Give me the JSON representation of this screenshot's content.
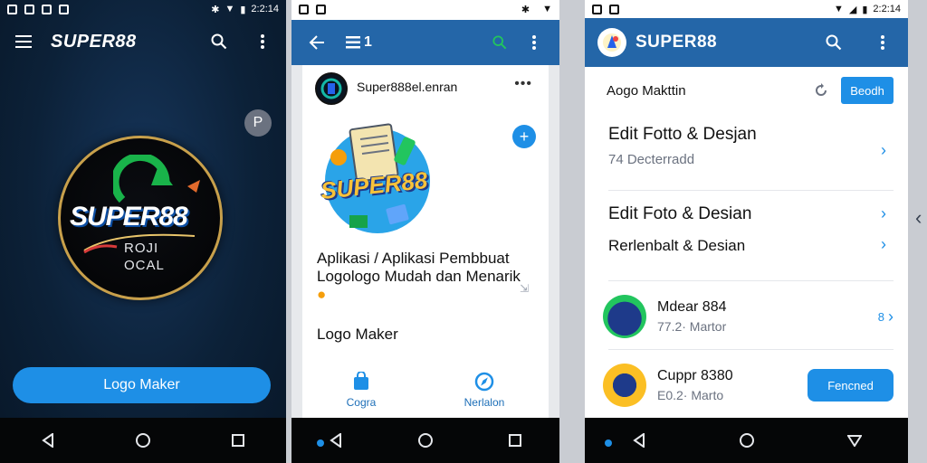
{
  "status": {
    "time": "2:2:14"
  },
  "phone1": {
    "app_title": "SUPER88",
    "logo_text": "SUPER88",
    "logo_sub_line1": "ROJI",
    "logo_sub_line2": "OCAL",
    "cta_label": "Logo Maker"
  },
  "phone2": {
    "appbar_title": "1",
    "account_name": "Super888el.enran",
    "logo_text": "SUPER88",
    "description": "Aplikasi / Aplikasi Pembbuat Logologo Mudah dan Menarik",
    "logomaker_label": "Logo Maker",
    "bottom": [
      {
        "label": "Cogra",
        "icon": "bag-icon"
      },
      {
        "label": "Nerlalon",
        "icon": "compass-icon"
      }
    ]
  },
  "phone3": {
    "app_title": "SUPER88",
    "row1_label": "Aogo Makttin",
    "row1_button": "Beodh",
    "items": [
      {
        "title": "Edit Fotto & Desjan",
        "subtitle": "74 Decterradd"
      },
      {
        "title": "Edit Foto & Desian",
        "subtitle": ""
      },
      {
        "title": "Rerlenbalt & Desian",
        "subtitle": ""
      }
    ],
    "list": [
      {
        "title": "Mdear 884",
        "subtitle": "77.2· Martor",
        "right_text": "8"
      },
      {
        "title": "Cuppr 8380",
        "subtitle": "E0.2· Marto",
        "button": "Fencned"
      }
    ]
  },
  "colors": {
    "primary": "#1e8fe6",
    "appbar": "#2466a8",
    "dark_bg": "#0c2138",
    "gold": "#c8a04b"
  }
}
